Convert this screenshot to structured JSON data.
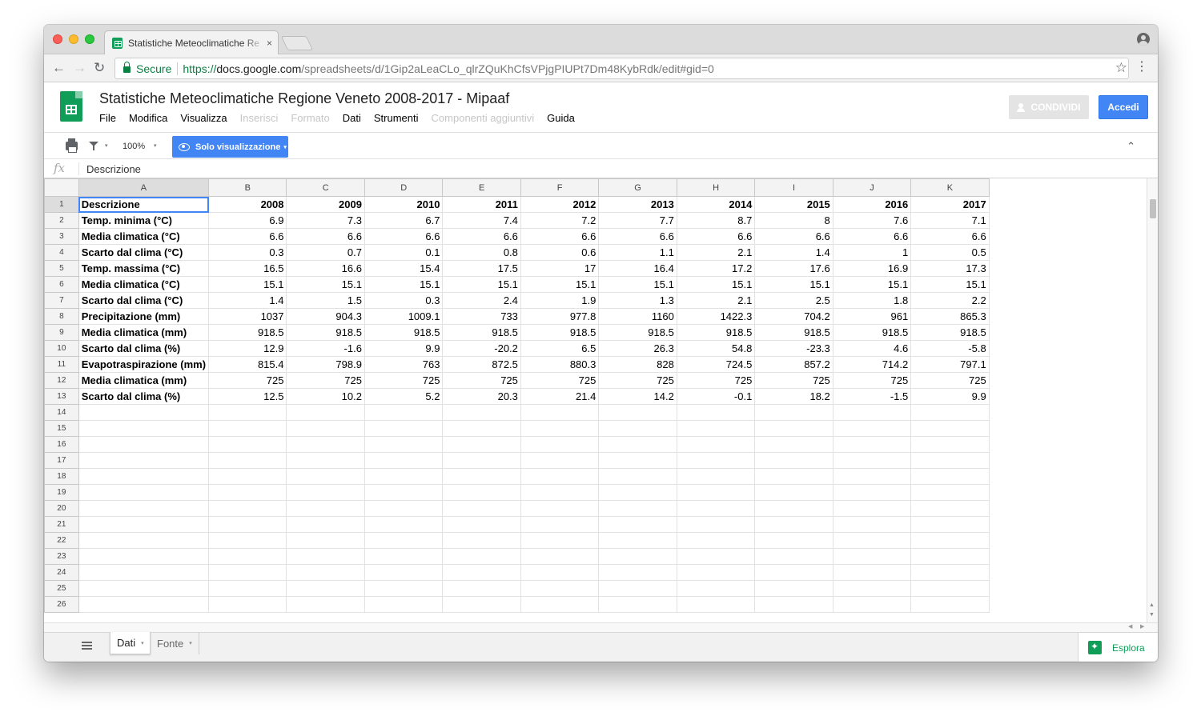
{
  "browser": {
    "tab_title": "Statistiche Meteoclimatiche Re",
    "tab_close": "×",
    "secure_label": "Secure",
    "url_scheme": "https://",
    "url_host": "docs.google.com",
    "url_path": "/spreadsheets/d/1Gip2aLeaCLo_qlrZQuKhCfsVPjgPIUPt7Dm48KybRdk/edit#gid=0",
    "back": "←",
    "forward": "→",
    "reload": "↻",
    "star": "☆",
    "menu": "⋮"
  },
  "doc": {
    "title": "Statistiche Meteoclimatiche Regione Veneto 2008-2017 - Mipaaf",
    "menu": [
      "File",
      "Modifica",
      "Visualizza",
      "Inserisci",
      "Formato",
      "Dati",
      "Strumenti",
      "Componenti aggiuntivi",
      "Guida"
    ],
    "menu_disabled": [
      false,
      false,
      false,
      true,
      true,
      false,
      false,
      true,
      false
    ],
    "share_label": "CONDIVIDI",
    "signin_label": "Accedi"
  },
  "toolbar": {
    "zoom": "100%",
    "view_only_label": "Solo visualizzazione",
    "caret": "▾",
    "collapse": "⌃"
  },
  "formula": {
    "fx": "fx",
    "content": "Descrizione"
  },
  "grid": {
    "columns": [
      "A",
      "B",
      "C",
      "D",
      "E",
      "F",
      "G",
      "H",
      "I",
      "J",
      "K"
    ],
    "total_rows": 26,
    "rows": [
      [
        "Descrizione",
        "2008",
        "2009",
        "2010",
        "2011",
        "2012",
        "2013",
        "2014",
        "2015",
        "2016",
        "2017"
      ],
      [
        "Temp. minima (°C)",
        "6.9",
        "7.3",
        "6.7",
        "7.4",
        "7.2",
        "7.7",
        "8.7",
        "8",
        "7.6",
        "7.1"
      ],
      [
        "Media climatica (°C)",
        "6.6",
        "6.6",
        "6.6",
        "6.6",
        "6.6",
        "6.6",
        "6.6",
        "6.6",
        "6.6",
        "6.6"
      ],
      [
        "Scarto dal clima (°C)",
        "0.3",
        "0.7",
        "0.1",
        "0.8",
        "0.6",
        "1.1",
        "2.1",
        "1.4",
        "1",
        "0.5"
      ],
      [
        "Temp. massima (°C)",
        "16.5",
        "16.6",
        "15.4",
        "17.5",
        "17",
        "16.4",
        "17.2",
        "17.6",
        "16.9",
        "17.3"
      ],
      [
        "Media climatica (°C)",
        "15.1",
        "15.1",
        "15.1",
        "15.1",
        "15.1",
        "15.1",
        "15.1",
        "15.1",
        "15.1",
        "15.1"
      ],
      [
        "Scarto dal clima (°C)",
        "1.4",
        "1.5",
        "0.3",
        "2.4",
        "1.9",
        "1.3",
        "2.1",
        "2.5",
        "1.8",
        "2.2"
      ],
      [
        "Precipitazione (mm)",
        "1037",
        "904.3",
        "1009.1",
        "733",
        "977.8",
        "1160",
        "1422.3",
        "704.2",
        "961",
        "865.3"
      ],
      [
        "Media climatica (mm)",
        "918.5",
        "918.5",
        "918.5",
        "918.5",
        "918.5",
        "918.5",
        "918.5",
        "918.5",
        "918.5",
        "918.5"
      ],
      [
        "Scarto dal clima (%)",
        "12.9",
        "-1.6",
        "9.9",
        "-20.2",
        "6.5",
        "26.3",
        "54.8",
        "-23.3",
        "4.6",
        "-5.8"
      ],
      [
        "Evapotraspirazione (mm)",
        "815.4",
        "798.9",
        "763",
        "872.5",
        "880.3",
        "828",
        "724.5",
        "857.2",
        "714.2",
        "797.1"
      ],
      [
        "Media climatica (mm)",
        "725",
        "725",
        "725",
        "725",
        "725",
        "725",
        "725",
        "725",
        "725",
        "725"
      ],
      [
        "Scarto dal clima (%)",
        "12.5",
        "10.2",
        "5.2",
        "20.3",
        "21.4",
        "14.2",
        "-0.1",
        "18.2",
        "-1.5",
        "9.9"
      ]
    ]
  },
  "sheets": {
    "tabs": [
      "Dati",
      "Fonte"
    ],
    "explore_label": "Esplora"
  },
  "colors": {
    "accent": "#4285f4",
    "sheets_green": "#0f9d58",
    "secure_green": "#0b8043"
  }
}
